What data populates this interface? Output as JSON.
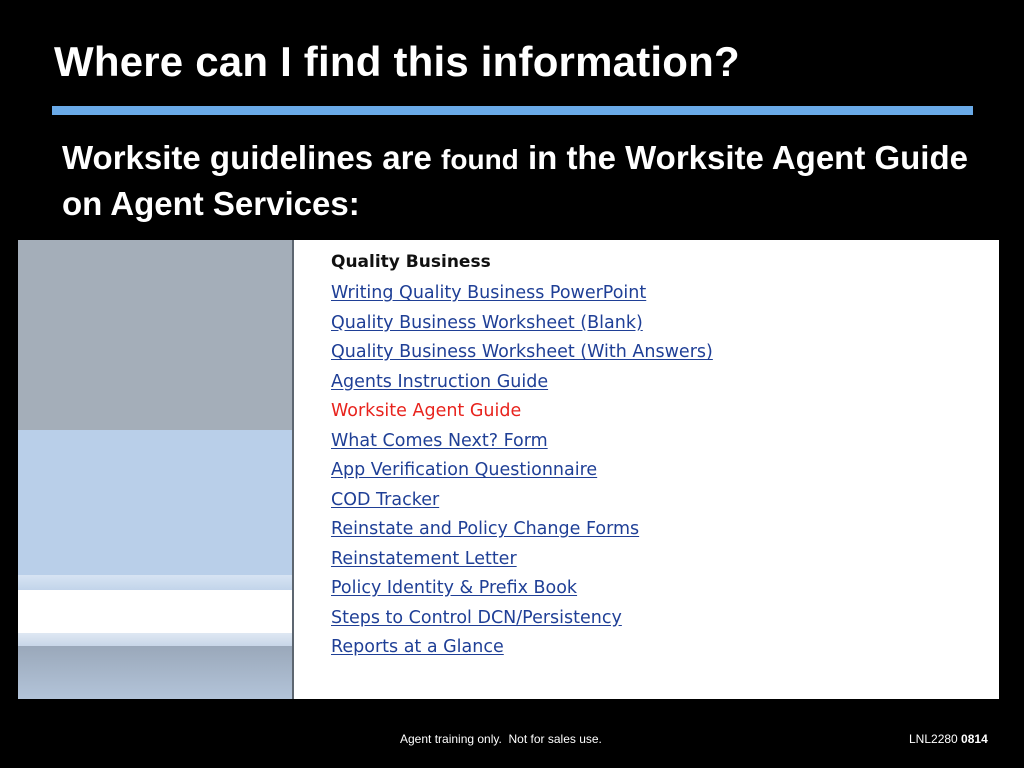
{
  "slide": {
    "title": "Where can I find this information?",
    "subtitle": {
      "part1": "Worksite guidelines are ",
      "part2": "found",
      "part3": " in the Worksite Agent Guide on Agent Services:"
    }
  },
  "screenshot": {
    "section_heading": "Quality Business",
    "links": [
      {
        "label": "Writing Quality Business PowerPoint"
      },
      {
        "label": "Quality Business Worksheet (Blank)"
      },
      {
        "label": "Quality Business Worksheet (With Answers)"
      },
      {
        "label": "Agents Instruction Guide"
      },
      {
        "label": "Worksite Agent Guide",
        "active": true
      },
      {
        "label": "What Comes Next? Form"
      },
      {
        "label": "App Verification Questionnaire"
      },
      {
        "label": "COD Tracker"
      },
      {
        "label": "Reinstate and Policy Change Forms"
      },
      {
        "label": "Reinstatement Letter"
      },
      {
        "label": "Policy Identity & Prefix Book"
      },
      {
        "label": "Steps to Control DCN/Persistency"
      },
      {
        "label": "Reports at a Glance"
      }
    ]
  },
  "footer": {
    "disclaimer": "Agent training only.  Not for sales use.",
    "code_prefix": "LNL2280 ",
    "code_number": "0814"
  },
  "colors": {
    "background": "#000000",
    "title_rule": "#6aaae8",
    "link": "#1f3f96",
    "active_link": "#e8231d"
  }
}
